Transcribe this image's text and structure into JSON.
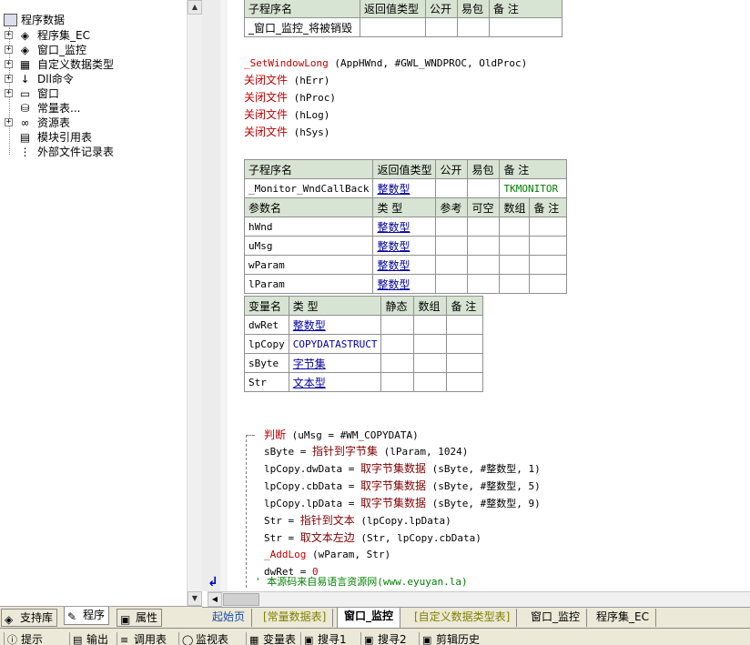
{
  "tree": {
    "root": "程序数据",
    "items": [
      {
        "label": "程序集_EC",
        "icon": "stack-icon",
        "glyph": "◈",
        "expand": "+"
      },
      {
        "label": "窗口_监控",
        "icon": "stack-icon",
        "glyph": "◈",
        "expand": "+"
      },
      {
        "label": "自定义数据类型",
        "icon": "grid-icon",
        "glyph": "▦",
        "expand": "+"
      },
      {
        "label": "Dll命令",
        "icon": "dll-icon",
        "glyph": "↓",
        "expand": "+"
      },
      {
        "label": "窗口",
        "icon": "window-icon",
        "glyph": "▭",
        "expand": "+"
      },
      {
        "label": "常量表...",
        "icon": "database-icon",
        "glyph": "⛁",
        "expand": ""
      },
      {
        "label": "资源表",
        "icon": "resource-icon",
        "glyph": "∞",
        "expand": "+"
      },
      {
        "label": "模块引用表",
        "icon": "module-icon",
        "glyph": "▤",
        "expand": ""
      },
      {
        "label": "外部文件记录表",
        "icon": "file-list-icon",
        "glyph": "⋮",
        "expand": ""
      }
    ]
  },
  "left_tabs": [
    {
      "label": "支持库",
      "icon": "library-icon",
      "glyph": "◈"
    },
    {
      "label": "程序",
      "icon": "program-icon",
      "glyph": "✎"
    },
    {
      "label": "属性",
      "icon": "properties-icon",
      "glyph": "▣"
    }
  ],
  "sub1": {
    "headers": [
      "子程序名",
      "返回值类型",
      "公开",
      "易包",
      "备 注"
    ],
    "row": [
      "_窗口_监控_将被销毁",
      "",
      "",
      "",
      ""
    ]
  },
  "code1": [
    {
      "fn": "_SetWindowLong",
      "args": " (AppHWnd, #GWL_WNDPROC, OldProc)"
    },
    {
      "fn": "关闭文件",
      "args": " (hErr)"
    },
    {
      "fn": "关闭文件",
      "args": " (hProc)"
    },
    {
      "fn": "关闭文件",
      "args": " (hLog)"
    },
    {
      "fn": "关闭文件",
      "args": " (hSys)"
    }
  ],
  "sub2": {
    "headers": [
      "子程序名",
      "返回值类型",
      "公开",
      "易包",
      "备 注"
    ],
    "row": [
      "_Monitor_WndCallBack",
      "整数型",
      "",
      "",
      "TKMONITOR"
    ],
    "param_headers": [
      "参数名",
      "类 型",
      "参考",
      "可空",
      "数组",
      "备 注"
    ],
    "params": [
      {
        "name": "hWnd",
        "type": "整数型"
      },
      {
        "name": "uMsg",
        "type": "整数型"
      },
      {
        "name": "wParam",
        "type": "整数型"
      },
      {
        "name": "lParam",
        "type": "整数型"
      }
    ]
  },
  "vars": {
    "headers": [
      "变量名",
      "类 型",
      "静态",
      "数组",
      "备 注"
    ],
    "rows": [
      {
        "name": "dwRet",
        "type": "整数型"
      },
      {
        "name": "lpCopy",
        "type": "COPYDATASTRUCT"
      },
      {
        "name": "sByte",
        "type": "字节集"
      },
      {
        "name": "Str",
        "type": "文本型"
      }
    ]
  },
  "code2": {
    "if_kw": "判断",
    "if_args": " (uMsg = #WM_COPYDATA)",
    "lines": [
      {
        "pre": "sByte = ",
        "fn": "指针到字节集",
        "post": " (lParam, 1024)"
      },
      {
        "pre": "lpCopy.dwData = ",
        "fn": "取字节集数据",
        "post": " (sByte, #整数型, 1)"
      },
      {
        "pre": "lpCopy.cbData = ",
        "fn": "取字节集数据",
        "post": " (sByte, #整数型, 5)"
      },
      {
        "pre": "lpCopy.lpData = ",
        "fn": "取字节集数据",
        "post": " (sByte, #整数型, 9)"
      },
      {
        "pre": "Str = ",
        "fn": "指针到文本",
        "post": " (lpCopy.lpData)"
      },
      {
        "pre": "Str = ",
        "fn": "取文本左边",
        "post": " (Str, lpCopy.cbData)"
      },
      {
        "pre": "",
        "fn": "_AddLog",
        "post": " (wParam, Str)"
      },
      {
        "pre": "dwRet = ",
        "fn": "",
        "post": "0"
      }
    ],
    "comment": "' 本源码来自易语言资源网(www.eyuyan.la)"
  },
  "doc_tabs": [
    {
      "label": "起始页",
      "style": "blue"
    },
    {
      "label": "[常量数据表]",
      "style": "olive"
    },
    {
      "label": "窗口_监控",
      "style": "active"
    },
    {
      "label": "[自定义数据类型表]",
      "style": "olive"
    },
    {
      "label": "窗口_监控",
      "style": "normal"
    },
    {
      "label": "程序集_EC",
      "style": "normal"
    }
  ],
  "bottom_tabs": [
    {
      "label": "提示",
      "icon": "info-icon",
      "glyph": "ⓘ"
    },
    {
      "label": "输出",
      "icon": "output-icon",
      "glyph": "▤"
    },
    {
      "label": "调用表",
      "icon": "callstack-icon",
      "glyph": "≡"
    },
    {
      "label": "监视表",
      "icon": "watch-icon",
      "glyph": "◯"
    },
    {
      "label": "变量表",
      "icon": "variables-icon",
      "glyph": "▦"
    },
    {
      "label": "搜寻1",
      "icon": "search-icon",
      "glyph": "▣"
    },
    {
      "label": "搜寻2",
      "icon": "search-icon",
      "glyph": "▣"
    },
    {
      "label": "剪辑历史",
      "icon": "clipboard-icon",
      "glyph": "▣"
    }
  ],
  "colors": {
    "header_bg": "#d8e4d3",
    "keyword": "#c00000",
    "type_link": "#0000a0",
    "remark": "#008000"
  }
}
